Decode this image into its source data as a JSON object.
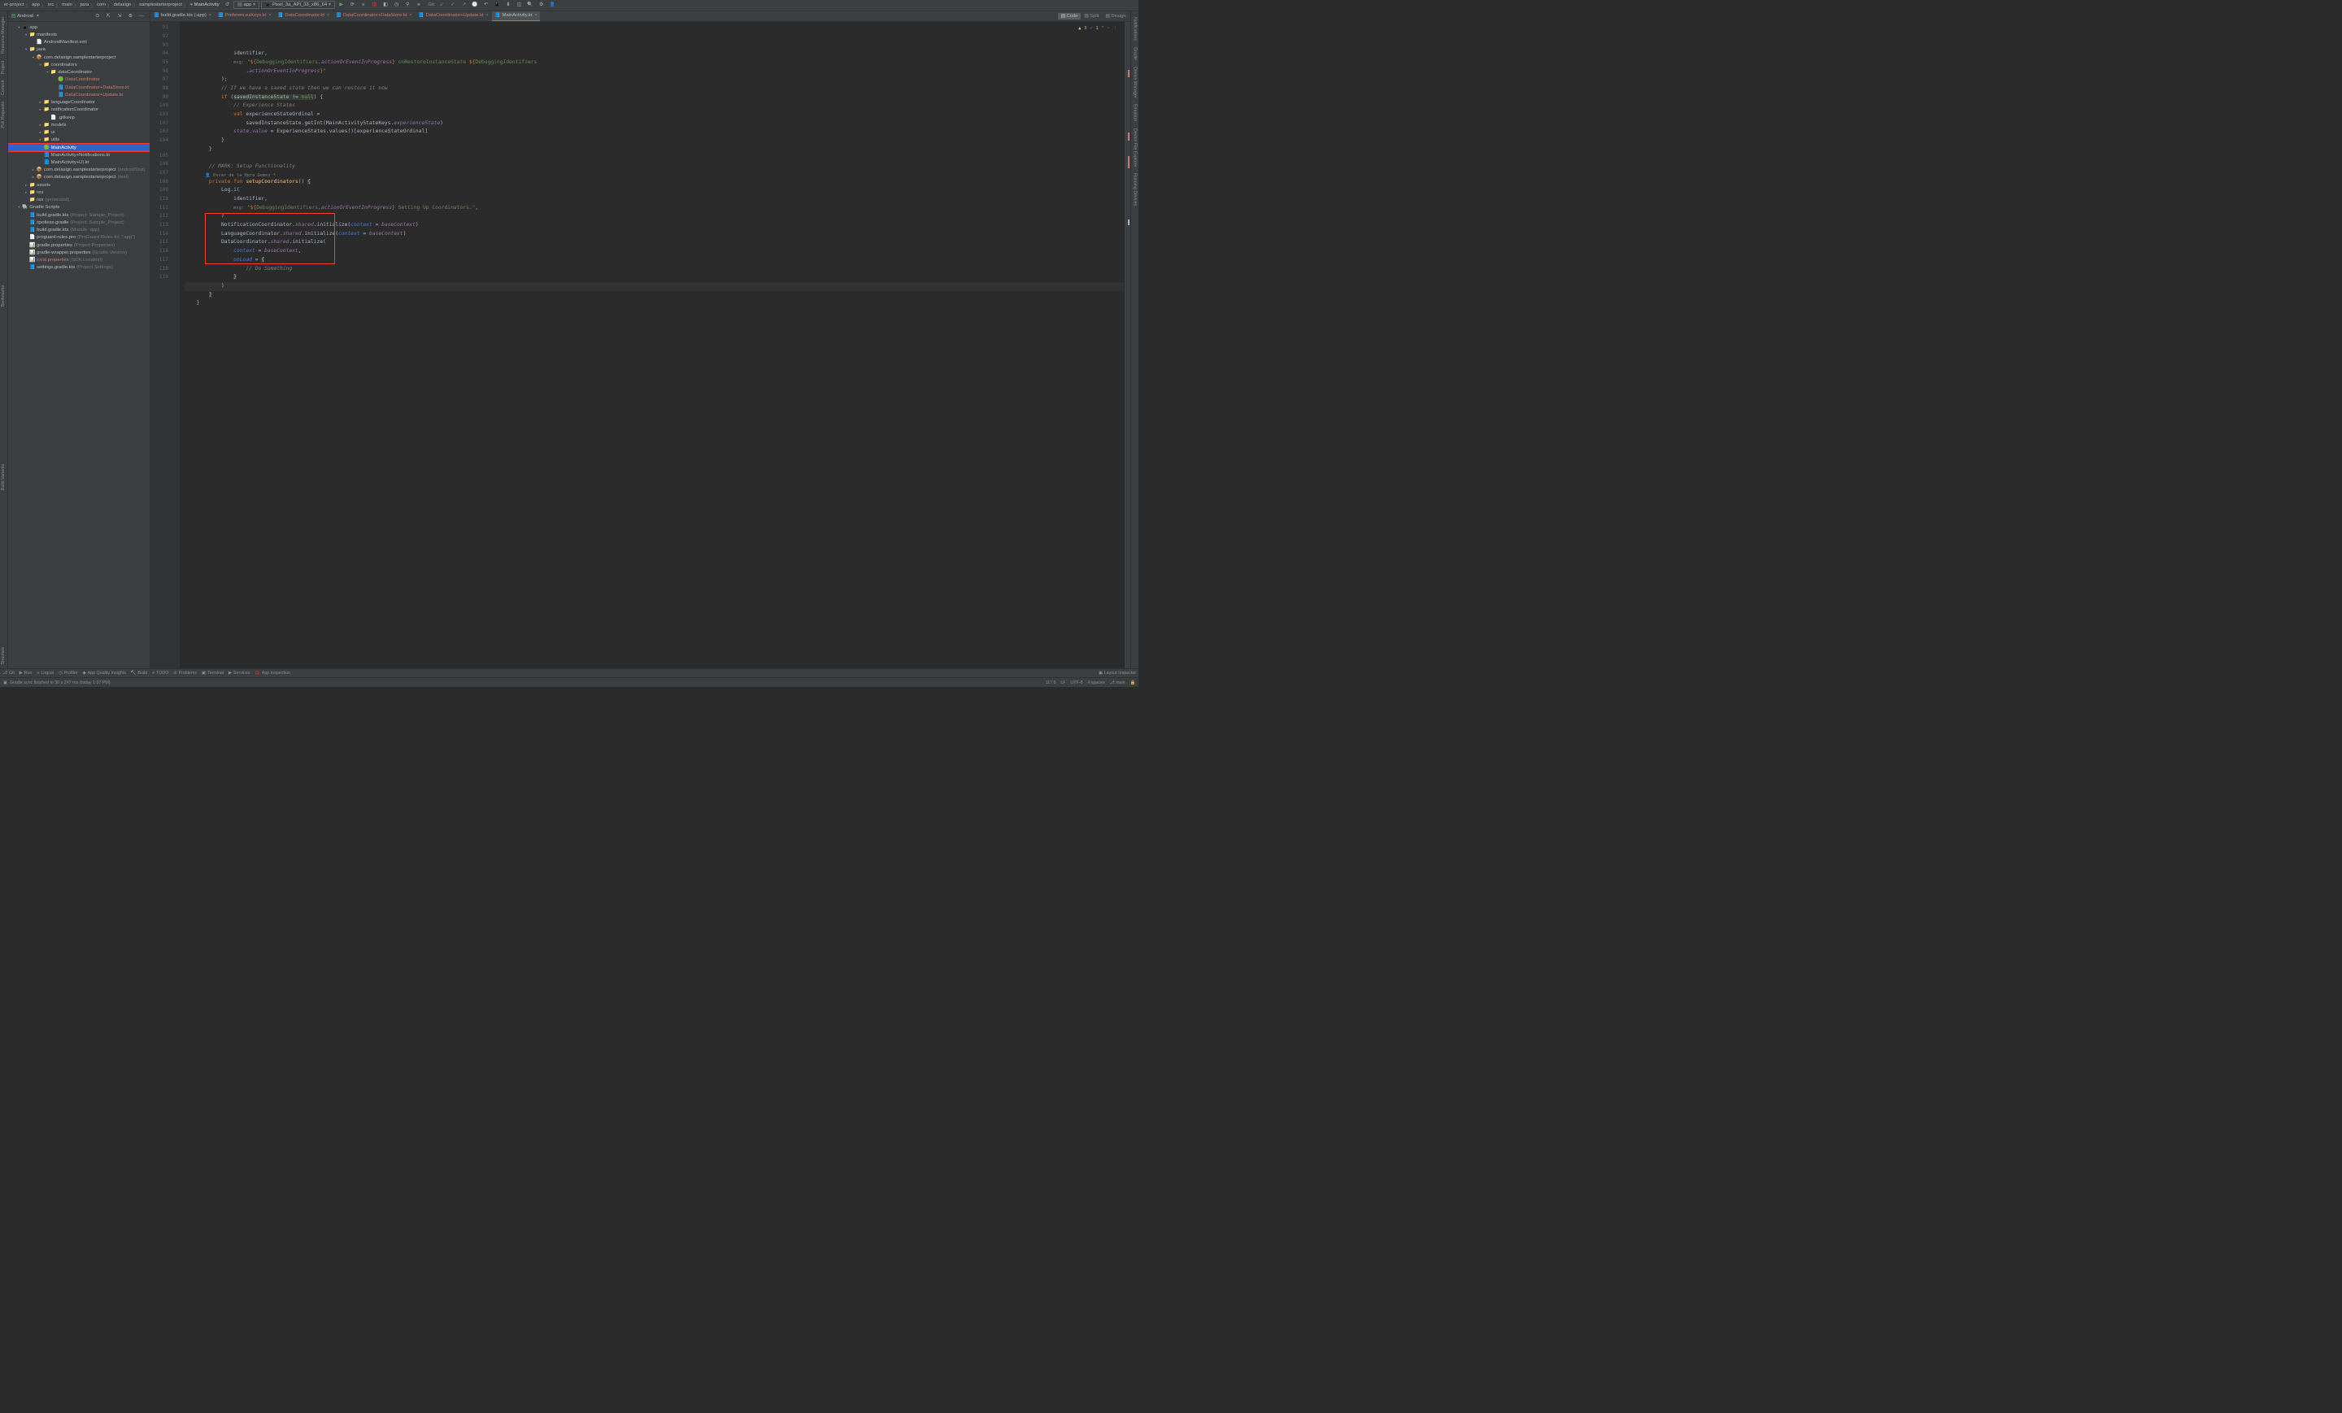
{
  "breadcrumb": [
    "er-project",
    "app",
    "src",
    "main",
    "java",
    "com",
    "delasign",
    "samplestarterproject",
    "MainActivity"
  ],
  "run_config": {
    "app": "app",
    "device": "Pixel_3a_API_33_x86_64"
  },
  "git_label": "Git:",
  "project": {
    "view": "Android",
    "tree": [
      {
        "depth": 0,
        "arrow": "▾",
        "icon": "📱",
        "label": "app",
        "type": "module"
      },
      {
        "depth": 1,
        "arrow": "▾",
        "icon": "📁",
        "label": "manifests",
        "type": "folder"
      },
      {
        "depth": 2,
        "arrow": "",
        "icon": "📄",
        "label": "AndroidManifest.xml",
        "type": "file"
      },
      {
        "depth": 1,
        "arrow": "▾",
        "icon": "📁",
        "label": "java",
        "type": "folder"
      },
      {
        "depth": 2,
        "arrow": "▾",
        "icon": "📦",
        "label": "com.delasign.samplestarterproject",
        "type": "package"
      },
      {
        "depth": 3,
        "arrow": "▾",
        "icon": "📁",
        "label": "coordinators",
        "type": "folder"
      },
      {
        "depth": 4,
        "arrow": "▾",
        "icon": "📁",
        "label": "dataCoordinator",
        "type": "folder"
      },
      {
        "depth": 5,
        "arrow": "",
        "icon": "🟢",
        "label": "DataCoordinator",
        "modified": true,
        "type": "class"
      },
      {
        "depth": 5,
        "arrow": "",
        "icon": "📘",
        "label": "DataCoordinator+DataStore.kt",
        "modified": true,
        "type": "kt"
      },
      {
        "depth": 5,
        "arrow": "",
        "icon": "📘",
        "label": "DataCoordinator+Update.kt",
        "modified": true,
        "type": "kt"
      },
      {
        "depth": 3,
        "arrow": "▸",
        "icon": "📁",
        "label": "languageCoordinator",
        "type": "folder"
      },
      {
        "depth": 3,
        "arrow": "▸",
        "icon": "📁",
        "label": "notificationCoordinator",
        "type": "folder"
      },
      {
        "depth": 4,
        "arrow": "",
        "icon": "📄",
        "label": ".gitkeep",
        "type": "file"
      },
      {
        "depth": 3,
        "arrow": "▸",
        "icon": "📁",
        "label": "models",
        "type": "folder"
      },
      {
        "depth": 3,
        "arrow": "▸",
        "icon": "📁",
        "label": "ui",
        "type": "folder"
      },
      {
        "depth": 3,
        "arrow": "▸",
        "icon": "📁",
        "label": "utils",
        "type": "folder"
      },
      {
        "depth": 3,
        "arrow": "",
        "icon": "🟢",
        "label": "MainActivity",
        "selected": true,
        "boxed": true,
        "type": "class"
      },
      {
        "depth": 3,
        "arrow": "",
        "icon": "📘",
        "label": "MainActivity+Notifications.kt",
        "type": "kt"
      },
      {
        "depth": 3,
        "arrow": "",
        "icon": "📘",
        "label": "MainActivity+UI.kt",
        "type": "kt"
      },
      {
        "depth": 2,
        "arrow": "▸",
        "icon": "📦",
        "label": "com.delasign.samplestarterproject",
        "hint": "(androidTest)",
        "type": "package"
      },
      {
        "depth": 2,
        "arrow": "▸",
        "icon": "📦",
        "label": "com.delasign.samplestarterproject",
        "hint": "(test)",
        "type": "package"
      },
      {
        "depth": 1,
        "arrow": "▸",
        "icon": "📁",
        "label": "assets",
        "type": "folder"
      },
      {
        "depth": 1,
        "arrow": "▸",
        "icon": "📁",
        "label": "res",
        "type": "folder"
      },
      {
        "depth": 1,
        "arrow": "",
        "icon": "📁",
        "label": "res",
        "hint": "(generated)",
        "type": "folder"
      },
      {
        "depth": 0,
        "arrow": "▾",
        "icon": "🐘",
        "label": "Gradle Scripts",
        "type": "scripts"
      },
      {
        "depth": 1,
        "arrow": "",
        "icon": "📘",
        "label": "build.gradle.kts",
        "hint": "(Project: Sample_Project)",
        "type": "file"
      },
      {
        "depth": 1,
        "arrow": "",
        "icon": "📘",
        "label": "spotless.gradle",
        "hint": "(Project: Sample_Project)",
        "type": "file"
      },
      {
        "depth": 1,
        "arrow": "",
        "icon": "📘",
        "label": "build.gradle.kts",
        "hint": "(Module :app)",
        "type": "file"
      },
      {
        "depth": 1,
        "arrow": "",
        "icon": "📄",
        "label": "proguard-rules.pro",
        "hint": "(ProGuard Rules for \":app\")",
        "type": "file"
      },
      {
        "depth": 1,
        "arrow": "",
        "icon": "📊",
        "label": "gradle.properties",
        "hint": "(Project Properties)",
        "type": "file"
      },
      {
        "depth": 1,
        "arrow": "",
        "icon": "📊",
        "label": "gradle-wrapper.properties",
        "hint": "(Gradle Version)",
        "type": "file"
      },
      {
        "depth": 1,
        "arrow": "",
        "icon": "📊",
        "label": "local.properties",
        "hint": "(SDK Location)",
        "modified": true,
        "type": "file"
      },
      {
        "depth": 1,
        "arrow": "",
        "icon": "📘",
        "label": "settings.gradle.kts",
        "hint": "(Project Settings)",
        "type": "file"
      }
    ]
  },
  "tabs": [
    {
      "label": "build.gradle.kts (:app)",
      "icon": "📘"
    },
    {
      "label": "PreferencesKeys.kt",
      "icon": "📘",
      "modified": true
    },
    {
      "label": "DataCoordinator.kt",
      "icon": "📘",
      "modified": true
    },
    {
      "label": "DataCoordinator+DataStore.kt",
      "icon": "📘",
      "modified": true
    },
    {
      "label": "DataCoordinator+Update.kt",
      "icon": "📘",
      "modified": true
    },
    {
      "label": "MainActivity.kt",
      "icon": "📘",
      "active": true
    }
  ],
  "viewmodes": [
    {
      "label": "Code",
      "active": true
    },
    {
      "label": "Split"
    },
    {
      "label": "Design"
    }
  ],
  "inspections": {
    "warnings": "3",
    "weak": "1"
  },
  "line_start": 91,
  "line_end": 119,
  "author_hint": "Oscar de la Hera Gomez *",
  "bottom_tools": [
    {
      "icon": "⎇",
      "label": "Git"
    },
    {
      "icon": "▶",
      "label": "Run"
    },
    {
      "icon": "≡",
      "label": "Logcat"
    },
    {
      "icon": "◷",
      "label": "Profiler"
    },
    {
      "icon": "◆",
      "label": "App Quality Insights"
    },
    {
      "icon": "🔨",
      "label": "Build"
    },
    {
      "icon": "≡",
      "label": "TODO"
    },
    {
      "icon": "⊘",
      "label": "Problems"
    },
    {
      "icon": "▣",
      "label": "Terminal"
    },
    {
      "icon": "▶",
      "label": "Services"
    },
    {
      "icon": "🐞",
      "label": "App Inspection"
    }
  ],
  "bottom_right": {
    "label": "Layout Inspector"
  },
  "status": {
    "message": "Gradle sync finished in 30 s 247 ms (today 1:37 PM)",
    "position": "117:6",
    "line_sep": "LF",
    "encoding": "UTF-8",
    "indent": "4 spaces",
    "branch": "main"
  },
  "left_gutter": [
    {
      "label": "Resource Manager"
    },
    {
      "label": "Project"
    },
    {
      "label": "Commit"
    },
    {
      "label": "Pull Requests"
    },
    {
      "label": "Bookmarks"
    },
    {
      "label": "Build Variants"
    },
    {
      "label": "Structure"
    }
  ],
  "right_gutter": [
    {
      "label": "Notifications"
    },
    {
      "label": "Gradle"
    },
    {
      "label": "Device Manager"
    },
    {
      "label": "Emulator"
    },
    {
      "label": "Device File Explorer"
    },
    {
      "label": "Running Devices"
    }
  ]
}
